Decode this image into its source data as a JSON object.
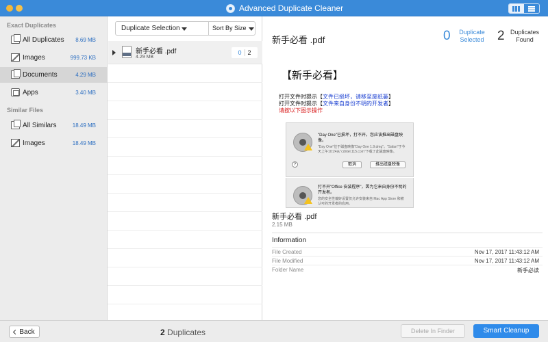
{
  "window": {
    "title": "Advanced Duplicate Cleaner",
    "app_icon": "app-logo-icon"
  },
  "view_toggle": {
    "options": [
      "grid-view-icon",
      "list-view-icon"
    ],
    "active": "list"
  },
  "sidebar": {
    "exact_header": "Exact Duplicates",
    "exact_items": [
      {
        "label": "All Duplicates",
        "size": "8.69 MB",
        "icon": "duplicates-icon",
        "selected": false
      },
      {
        "label": "Images",
        "size": "999.73 KB",
        "icon": "image-icon",
        "selected": false
      },
      {
        "label": "Documents",
        "size": "4.29 MB",
        "icon": "documents-icon",
        "selected": true
      },
      {
        "label": "Apps",
        "size": "3.40 MB",
        "icon": "apps-icon",
        "selected": false
      }
    ],
    "similar_header": "Similar Files",
    "similar_items": [
      {
        "label": "All Similars",
        "size": "18.49 MB",
        "icon": "duplicates-icon",
        "selected": false
      },
      {
        "label": "Images",
        "size": "18.49 MB",
        "icon": "image-icon",
        "selected": false
      }
    ]
  },
  "middle": {
    "selection_menu": "Duplicate Selection",
    "sort_menu": "Sort By Size",
    "groups": [
      {
        "name": "新手必看 .pdf",
        "size": "4.29 MB",
        "selected_count": "0",
        "total_count": "2"
      }
    ]
  },
  "detail": {
    "file_title": "新手必看 .pdf",
    "stats": {
      "selected_num": "0",
      "selected_label_1": "Duplicate",
      "selected_label_2": "Selected",
      "found_num": "2",
      "found_label_1": "Duplicates",
      "found_label_2": "Found"
    },
    "preview": {
      "heading": "【新手必看】",
      "line1_a": "打开文件时提示【",
      "line1_b": "文件已损坏，请移至废纸篓",
      "line1_c": "】",
      "line2_a": "打开文件时提示【",
      "line2_b": "文件来自身份不明的开发者",
      "line2_c": "】",
      "line3": "请按以下图示操作",
      "dialog1_title": "\"Day One\"已损坏，打不开。您应该推出磁盘映像。",
      "dialog1_sub": "\"Day One\"位于磁盘映像\"Day One 1.9.dmg\"。\"Safari\"于今天上午10:24从\"cdntel.115.com\"下载了此磁盘映像。",
      "dialog1_cancel": "取消",
      "dialog1_eject": "推出磁盘映像",
      "dialog1_help": "?",
      "dialog2_title": "打不开\"Office 安装程序\"，因为它来自身份不明的开发者。",
      "dialog2_sub": "您的安全性偏好设置仅允许安装来自 Mac App Store 和被认可的开发者的应用。"
    },
    "file_name": "新手必看 .pdf",
    "file_size": "2.15 MB",
    "info_header": "Information",
    "info": [
      {
        "key": "File Created",
        "value": "Nov 17, 2017 11:43:12 AM"
      },
      {
        "key": "File Modified",
        "value": "Nov 17, 2017 11:43:12 AM"
      },
      {
        "key": "Folder Name",
        "value": "新手必读"
      }
    ]
  },
  "bottom": {
    "back_label": "Back",
    "dup_count_num": "2",
    "dup_count_label": "Duplicates",
    "delete_label": "Delete In Finder",
    "smart_label": "Smart Cleanup"
  },
  "colors": {
    "accent": "#3a8ad9",
    "button": "#2f8bea",
    "sidebar_bg": "#ececec"
  }
}
